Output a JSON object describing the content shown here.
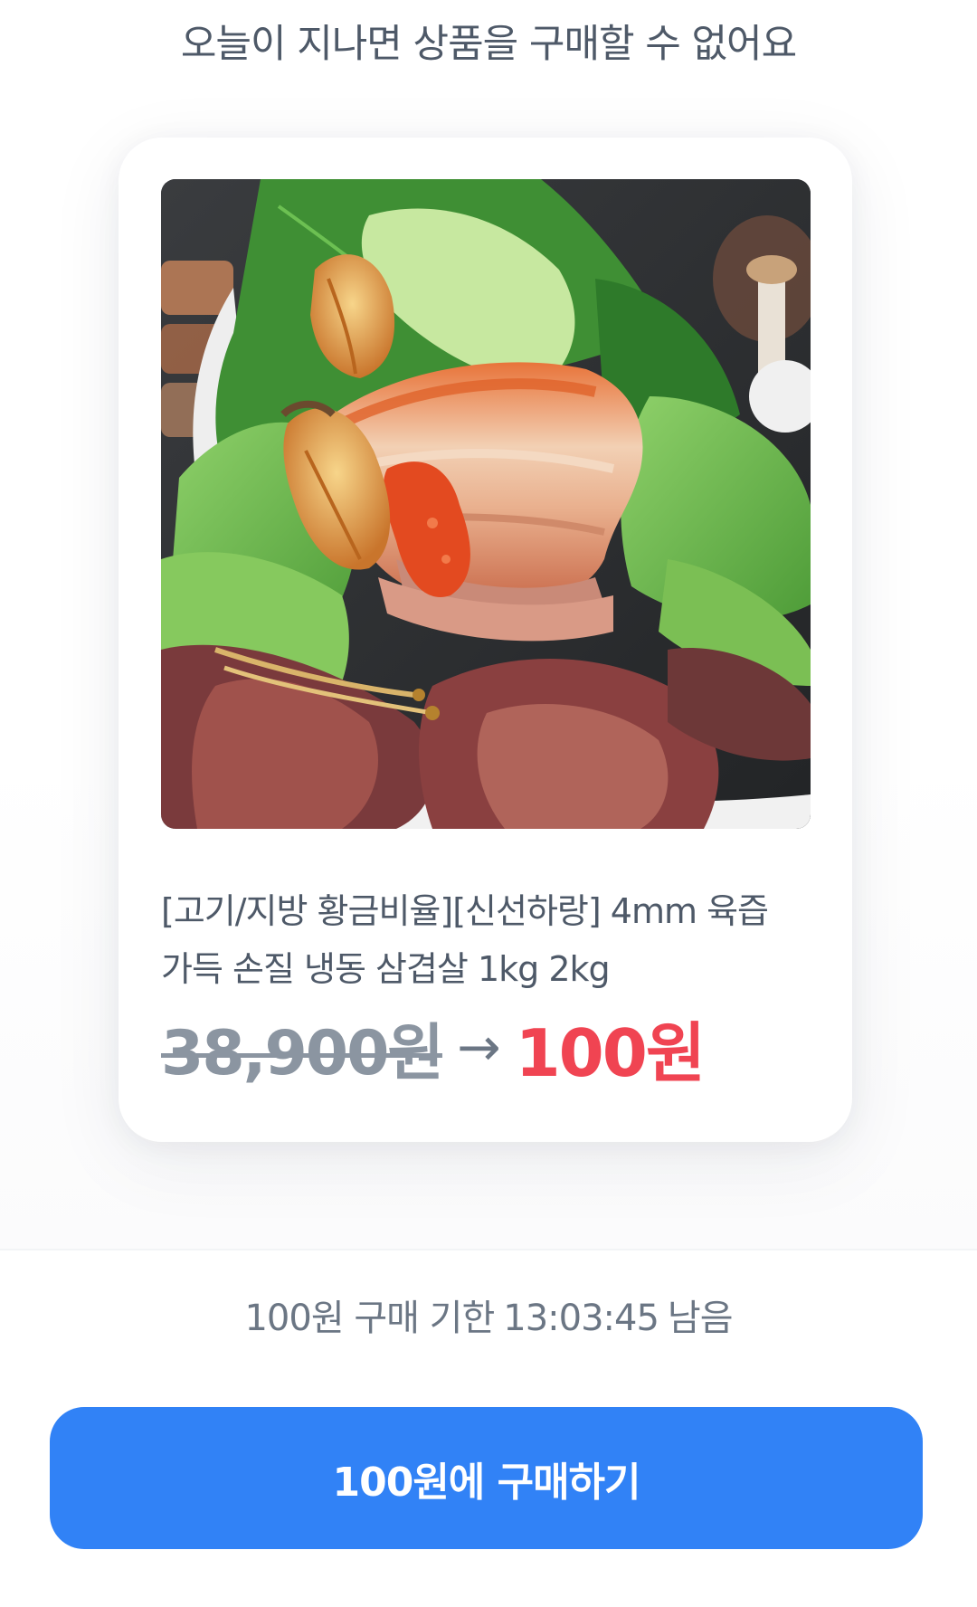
{
  "header": {
    "headline": "오늘이 지나면 상품을 구매할 수 없어요"
  },
  "product": {
    "image_alt": "삼겹살 쌈 이미지",
    "title_line1": "[고기/지방 황금비율][신선하랑] 4mm 육즙",
    "title_line2": "가득 손질 냉동 삼겹살 1kg 2kg",
    "original_price": "38,900원",
    "sale_price": "100원",
    "arrow": "→"
  },
  "deadline": {
    "prefix": "100원 구매 기한",
    "time": "13:03:45",
    "suffix": "남음"
  },
  "cta": {
    "label": "100원에 구매하기"
  },
  "colors": {
    "accent": "#3182f6",
    "sale": "#f04452",
    "muted_price": "#8b95a1",
    "text_secondary": "#4e5968"
  }
}
